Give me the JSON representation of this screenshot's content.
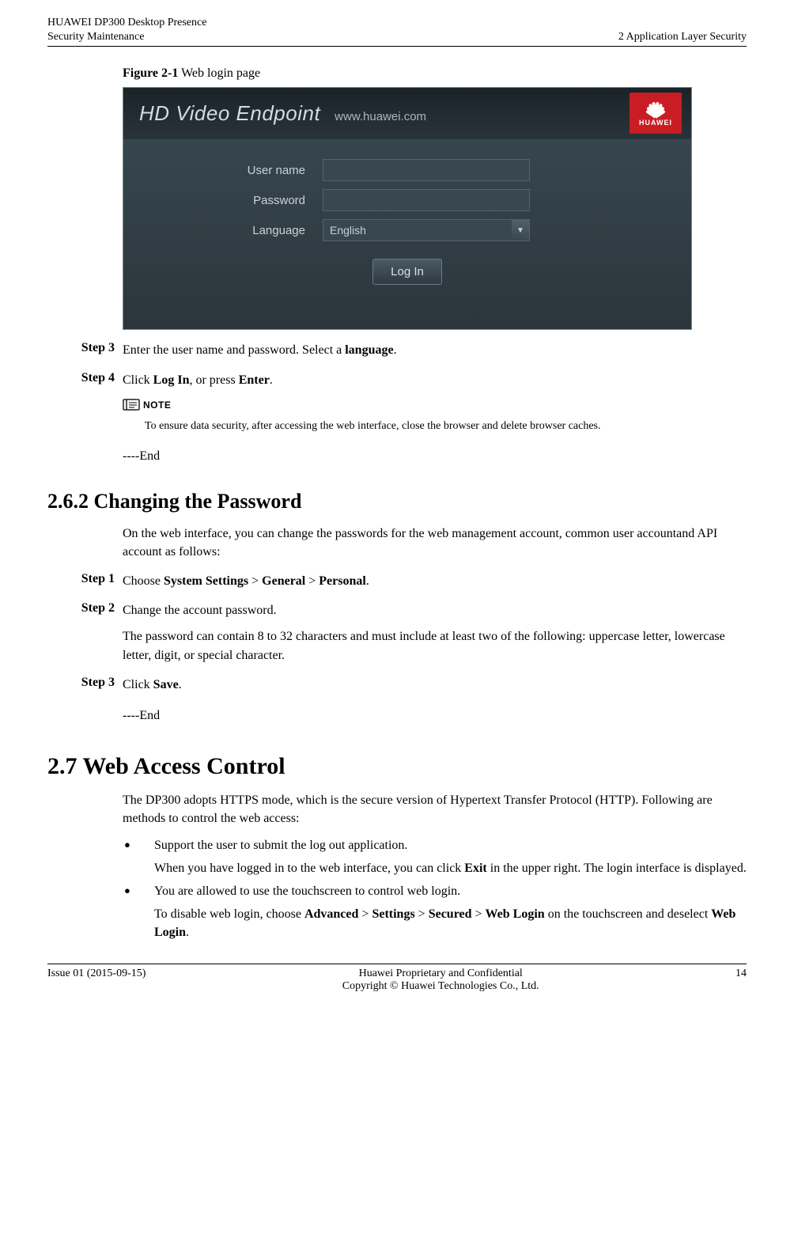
{
  "header": {
    "left_line1": "HUAWEI DP300 Desktop Presence",
    "left_line2": "Security Maintenance",
    "right": "2 Application Layer Security"
  },
  "figure": {
    "label": "Figure 2-1",
    "caption": "Web login page",
    "panel": {
      "title": "HD Video Endpoint",
      "url": "www.huawei.com",
      "logo_text": "HUAWEI",
      "username_label": "User name",
      "password_label": "Password",
      "language_label": "Language",
      "language_value": "English",
      "login_button": "Log In"
    }
  },
  "steps_a": {
    "s3_label": "Step 3",
    "s3_text_1": "Enter the user name and password. Select a ",
    "s3_bold": "language",
    "s3_text_2": ".",
    "s4_label": "Step 4",
    "s4_text_1": "Click ",
    "s4_bold": "Log In",
    "s4_text_2": ", or press ",
    "s4_bold2": "Enter",
    "s4_text_3": "."
  },
  "note": {
    "label": "NOTE",
    "text": "To ensure data security, after accessing the web interface, close the browser and delete browser caches."
  },
  "end": "----End",
  "section_262": {
    "heading": "2.6.2 Changing the Password",
    "intro": "On the web interface, you can change the passwords for the web management account, common user accountand API account as follows:",
    "s1_label": "Step 1",
    "s1_text_1": "Choose ",
    "s1_b1": "System Settings",
    "s1_sep": " > ",
    "s1_b2": "General",
    "s1_b3": "Personal",
    "s1_text_2": ".",
    "s2_label": "Step 2",
    "s2_text": "Change the account password.",
    "s2_para": "The password can contain 8 to 32 characters and must include at least two of the following: uppercase letter, lowercase letter, digit, or special character.",
    "s3_label": "Step 3",
    "s3_text_1": "Click ",
    "s3_bold": "Save",
    "s3_text_2": "."
  },
  "section_27": {
    "heading": "2.7 Web Access Control",
    "intro": "The DP300 adopts HTTPS mode, which is the secure version of Hypertext Transfer Protocol (HTTP). Following are methods to control the web access:",
    "b1_line1": "Support the user to submit the log out application.",
    "b1_line2_a": "When you have logged in to the web interface, you can click ",
    "b1_line2_bold": "Exit",
    "b1_line2_b": " in the upper right. The login interface is displayed.",
    "b2_line1": "You are allowed to use the touchscreen to control web login.",
    "b2_line2_a": "To disable web login, choose ",
    "b2_b1": "Advanced",
    "b2_sep": " > ",
    "b2_b2": "Settings",
    "b2_b3": "Secured",
    "b2_b4": "Web Login",
    "b2_line2_b": " on the touchscreen and deselect ",
    "b2_b5": "Web Login",
    "b2_line2_c": "."
  },
  "footer": {
    "left": "Issue 01 (2015-09-15)",
    "center1": "Huawei Proprietary and Confidential",
    "center2": "Copyright © Huawei Technologies Co., Ltd.",
    "right": "14"
  }
}
